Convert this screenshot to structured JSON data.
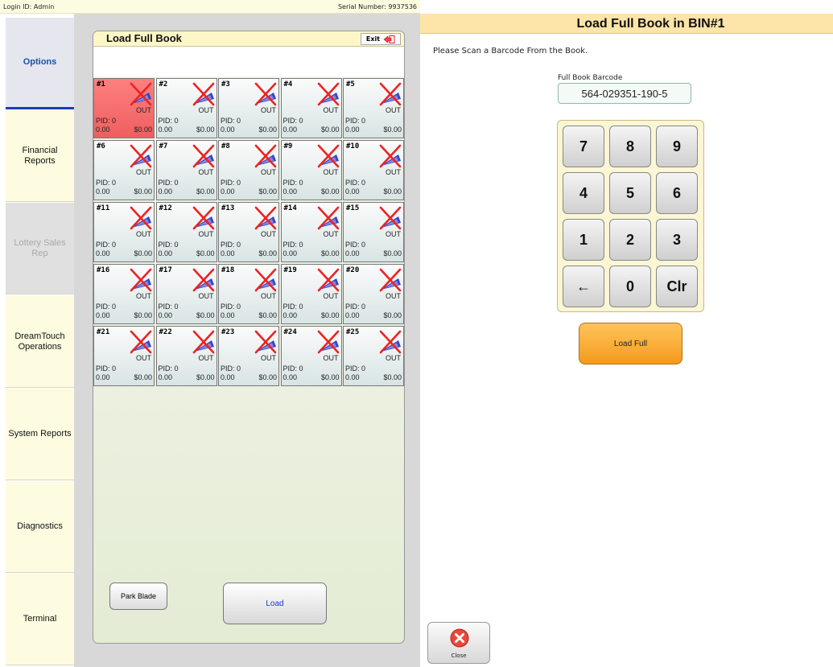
{
  "topbar": {
    "login": "Login ID: Admin",
    "serial": "Serial Number: 9937536"
  },
  "sidebar": {
    "items": [
      {
        "label": "Options",
        "state": "active"
      },
      {
        "label": "Financial Reports",
        "state": "normal"
      },
      {
        "label": "Lottery Sales Rep",
        "state": "disabled"
      },
      {
        "label": "DreamTouch Operations",
        "state": "normal"
      },
      {
        "label": "System Reports",
        "state": "normal"
      },
      {
        "label": "Diagnostics",
        "state": "normal"
      },
      {
        "label": "Terminal",
        "state": "normal"
      }
    ]
  },
  "panel": {
    "title": "Load Full Book",
    "exit_label": "Exit",
    "selected_bin": "#1",
    "bins": [
      {
        "num": "#1",
        "status": "OUT",
        "pid": "PID: 0",
        "count": "0.00",
        "amount": "$0.00"
      },
      {
        "num": "#2",
        "status": "OUT",
        "pid": "PID: 0",
        "count": "0.00",
        "amount": "$0.00"
      },
      {
        "num": "#3",
        "status": "OUT",
        "pid": "PID: 0",
        "count": "0.00",
        "amount": "$0.00"
      },
      {
        "num": "#4",
        "status": "OUT",
        "pid": "PID: 0",
        "count": "0.00",
        "amount": "$0.00"
      },
      {
        "num": "#5",
        "status": "OUT",
        "pid": "PID: 0",
        "count": "0.00",
        "amount": "$0.00"
      },
      {
        "num": "#6",
        "status": "OUT",
        "pid": "PID: 0",
        "count": "0.00",
        "amount": "$0.00"
      },
      {
        "num": "#7",
        "status": "OUT",
        "pid": "PID: 0",
        "count": "0.00",
        "amount": "$0.00"
      },
      {
        "num": "#8",
        "status": "OUT",
        "pid": "PID: 0",
        "count": "0.00",
        "amount": "$0.00"
      },
      {
        "num": "#9",
        "status": "OUT",
        "pid": "PID: 0",
        "count": "0.00",
        "amount": "$0.00"
      },
      {
        "num": "#10",
        "status": "OUT",
        "pid": "PID: 0",
        "count": "0.00",
        "amount": "$0.00"
      },
      {
        "num": "#11",
        "status": "OUT",
        "pid": "PID: 0",
        "count": "0.00",
        "amount": "$0.00"
      },
      {
        "num": "#12",
        "status": "OUT",
        "pid": "PID: 0",
        "count": "0.00",
        "amount": "$0.00"
      },
      {
        "num": "#13",
        "status": "OUT",
        "pid": "PID: 0",
        "count": "0.00",
        "amount": "$0.00"
      },
      {
        "num": "#14",
        "status": "OUT",
        "pid": "PID: 0",
        "count": "0.00",
        "amount": "$0.00"
      },
      {
        "num": "#15",
        "status": "OUT",
        "pid": "PID: 0",
        "count": "0.00",
        "amount": "$0.00"
      },
      {
        "num": "#16",
        "status": "OUT",
        "pid": "PID: 0",
        "count": "0.00",
        "amount": "$0.00"
      },
      {
        "num": "#17",
        "status": "OUT",
        "pid": "PID: 0",
        "count": "0.00",
        "amount": "$0.00"
      },
      {
        "num": "#18",
        "status": "OUT",
        "pid": "PID: 0",
        "count": "0.00",
        "amount": "$0.00"
      },
      {
        "num": "#19",
        "status": "OUT",
        "pid": "PID: 0",
        "count": "0.00",
        "amount": "$0.00"
      },
      {
        "num": "#20",
        "status": "OUT",
        "pid": "PID: 0",
        "count": "0.00",
        "amount": "$0.00"
      },
      {
        "num": "#21",
        "status": "OUT",
        "pid": "PID: 0",
        "count": "0.00",
        "amount": "$0.00"
      },
      {
        "num": "#22",
        "status": "OUT",
        "pid": "PID: 0",
        "count": "0.00",
        "amount": "$0.00"
      },
      {
        "num": "#23",
        "status": "OUT",
        "pid": "PID: 0",
        "count": "0.00",
        "amount": "$0.00"
      },
      {
        "num": "#24",
        "status": "OUT",
        "pid": "PID: 0",
        "count": "0.00",
        "amount": "$0.00"
      },
      {
        "num": "#25",
        "status": "OUT",
        "pid": "PID: 0",
        "count": "0.00",
        "amount": "$0.00"
      }
    ],
    "park_label": "Park Blade",
    "load_label": "Load"
  },
  "right": {
    "title": "Load Full Book in BIN#1",
    "instruction": "Please Scan a Barcode From the Book.",
    "barcode_label": "Full Book Barcode",
    "barcode_value": "564-029351-190-5",
    "keys": [
      "7",
      "8",
      "9",
      "4",
      "5",
      "6",
      "1",
      "2",
      "3",
      "←",
      "0",
      "Clr"
    ],
    "load_full_label": "Load Full",
    "close_label": "Close"
  },
  "colors": {
    "header_bg": "#fde4a8",
    "panel_header": "#fdf7c8",
    "selected_bin": "#ff7f7f",
    "load_full": "#f59a1c",
    "active_nav": "#1a3fae",
    "sidebar_bg": "#fdfbe0"
  }
}
